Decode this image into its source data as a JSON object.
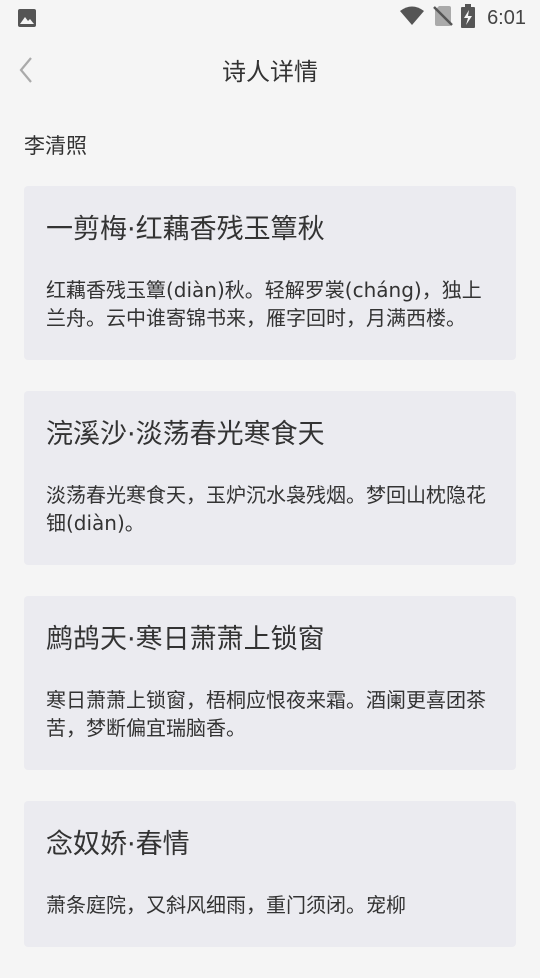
{
  "status_bar": {
    "time": "6:01",
    "icons": [
      "image-icon",
      "wifi-icon",
      "no-sim-icon",
      "battery-charging-icon"
    ]
  },
  "header": {
    "title": "诗人详情",
    "back_icon": "chevron-left-icon"
  },
  "poet": {
    "name": "李清照"
  },
  "poems": [
    {
      "title": "一剪梅·红藕香残玉簟秋",
      "excerpt": "红藕香残玉簟(diàn)秋。轻解罗裳(cháng)，独上兰舟。云中谁寄锦书来，雁字回时，月满西楼。"
    },
    {
      "title": "浣溪沙·淡荡春光寒食天",
      "excerpt": "淡荡春光寒食天，玉炉沉水袅残烟。梦回山枕隐花钿(diàn)。"
    },
    {
      "title": "鹧鸪天·寒日萧萧上锁窗",
      "excerpt": "寒日萧萧上锁窗，梧桐应恨夜来霜。酒阑更喜团茶苦，梦断偏宜瑞脑香。"
    },
    {
      "title": "念奴娇·春情",
      "excerpt": "萧条庭院，又斜风细雨，重门须闭。宠柳"
    }
  ],
  "colors": {
    "background": "#f5f5f5",
    "card": "#ebebf0",
    "text": "#333333"
  }
}
